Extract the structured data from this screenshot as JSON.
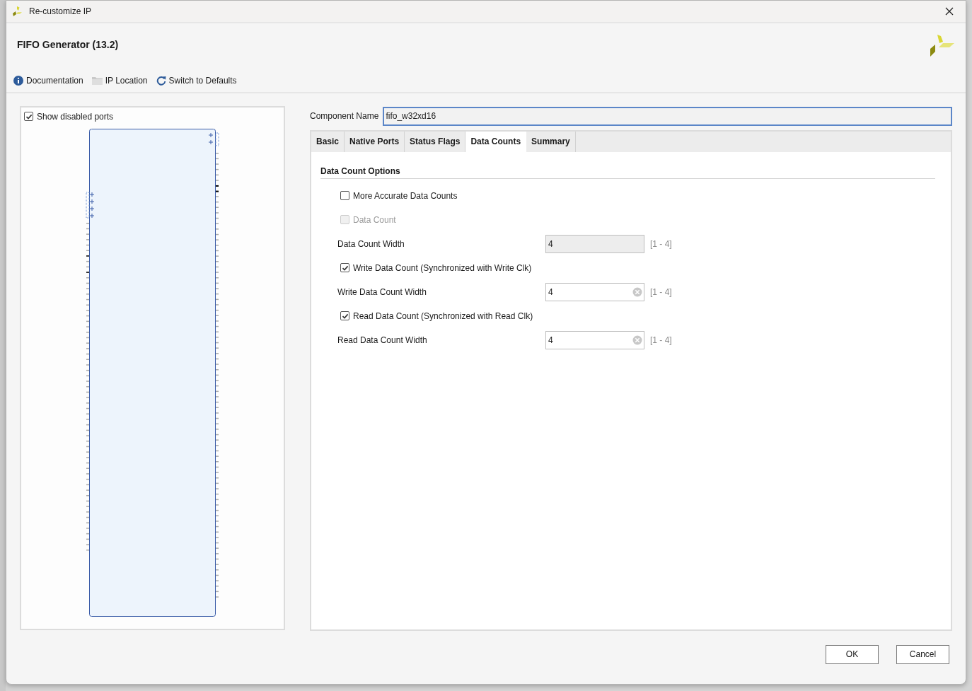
{
  "window": {
    "title": "Re-customize IP"
  },
  "header": {
    "title": "FIFO Generator (13.2)"
  },
  "toolbar": [
    {
      "kind": "info",
      "label": "Documentation"
    },
    {
      "kind": "folder",
      "label": "IP Location"
    },
    {
      "kind": "refresh",
      "label": "Switch to Defaults"
    }
  ],
  "symbol_panel": {
    "show_disabled_ports": {
      "label": "Show disabled ports",
      "checked": true
    }
  },
  "component_name": {
    "label": "Component Name",
    "value": "fifo_w32xd16"
  },
  "tabs": [
    {
      "label": "Basic",
      "selected": false
    },
    {
      "label": "Native Ports",
      "selected": false
    },
    {
      "label": "Status Flags",
      "selected": false
    },
    {
      "label": "Data Counts",
      "selected": true
    },
    {
      "label": "Summary",
      "selected": false
    }
  ],
  "section": {
    "title": "Data Count Options"
  },
  "options": [
    {
      "kind": "checkbox",
      "label": "More Accurate Data Counts",
      "checked": false,
      "disabled": false
    },
    {
      "kind": "checkbox",
      "label": "Data Count",
      "checked": false,
      "disabled": true
    },
    {
      "kind": "field",
      "label": "Data Count Width",
      "value": "4",
      "disabled": true,
      "range": "[1 - 4]"
    },
    {
      "kind": "checkbox",
      "label": "Write Data Count (Synchronized with Write Clk)",
      "checked": true,
      "disabled": false
    },
    {
      "kind": "field",
      "label": "Write Data Count Width",
      "value": "4",
      "disabled": false,
      "range": "[1 - 4]"
    },
    {
      "kind": "checkbox",
      "label": "Read Data Count (Synchronized with Read Clk)",
      "checked": true,
      "disabled": false
    },
    {
      "kind": "field",
      "label": "Read Data Count Width",
      "value": "4",
      "disabled": false,
      "range": "[1 - 4]"
    }
  ],
  "buttons": [
    {
      "label": "OK"
    },
    {
      "label": "Cancel"
    }
  ]
}
